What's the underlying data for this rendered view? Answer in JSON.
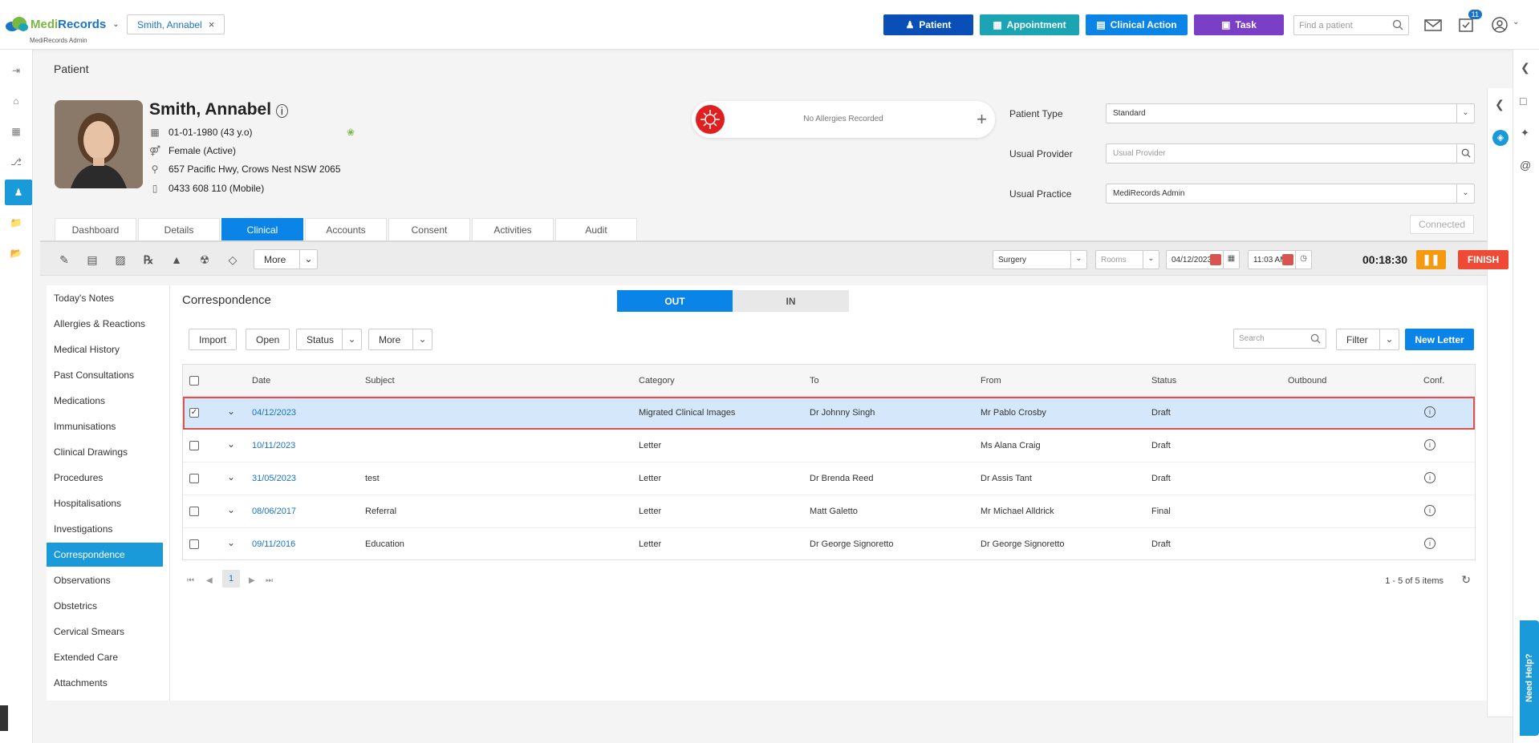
{
  "app": {
    "brand_medi": "Medi",
    "brand_records": "Records",
    "brand_sub": "MediRecords Admin"
  },
  "topbar": {
    "patient_chip": "Smith, Annabel",
    "buttons": [
      {
        "label": "Patient",
        "color": "#0a4fb8"
      },
      {
        "label": "Appointment",
        "color": "#1aa4b4"
      },
      {
        "label": "Clinical Action",
        "color": "#0a84e6"
      },
      {
        "label": "Task",
        "color": "#7a3fc6"
      }
    ],
    "find_placeholder": "Find a patient",
    "task_badge": "11"
  },
  "page": {
    "title": "Patient"
  },
  "patient": {
    "name": "Smith, Annabel",
    "dob": "01-01-1980 (43 y.o)",
    "gender": "Female (Active)",
    "address": "657 Pacific Hwy, Crows Nest NSW 2065",
    "phone": "0433 608 110 (Mobile)"
  },
  "allergies": {
    "text": "No Allergies Recorded"
  },
  "fields": {
    "patient_type_label": "Patient Type",
    "patient_type_value": "Standard",
    "usual_provider_label": "Usual Provider",
    "usual_provider_placeholder": "Usual Provider",
    "usual_practice_label": "Usual Practice",
    "usual_practice_value": "MediRecords Admin",
    "connected": "Connected"
  },
  "tabs": [
    {
      "label": "Dashboard"
    },
    {
      "label": "Details"
    },
    {
      "label": "Clinical"
    },
    {
      "label": "Accounts"
    },
    {
      "label": "Consent"
    },
    {
      "label": "Activities"
    },
    {
      "label": "Audit"
    }
  ],
  "toolbar": {
    "more": "More",
    "surgery": "Surgery",
    "rooms": "Rooms",
    "date": "04/12/2023",
    "time": "11:03 AM",
    "timer": "00:18:30",
    "finish": "FINISH"
  },
  "clinical_menu": [
    "Today's Notes",
    "Allergies & Reactions",
    "Medical History",
    "Past Consultations",
    "Medications",
    "Immunisations",
    "Clinical Drawings",
    "Procedures",
    "Hospitalisations",
    "Investigations",
    "Correspondence",
    "Observations",
    "Obstetrics",
    "Cervical Smears",
    "Extended Care",
    "Attachments"
  ],
  "correspondence": {
    "title": "Correspondence",
    "out_label": "OUT",
    "in_label": "IN",
    "import": "Import",
    "open": "Open",
    "status": "Status",
    "more": "More",
    "search_placeholder": "Search",
    "filter": "Filter",
    "new_letter": "New Letter",
    "columns": [
      "Date",
      "Subject",
      "Category",
      "To",
      "From",
      "Status",
      "Outbound",
      "Conf."
    ],
    "rows": [
      {
        "date": "04/12/2023",
        "subject": "",
        "category": "Migrated Clinical Images",
        "to": "Dr Johnny Singh",
        "from": "Mr Pablo Crosby",
        "status": "Draft"
      },
      {
        "date": "10/11/2023",
        "subject": "",
        "category": "Letter",
        "to": "",
        "from": "Ms Alana Craig",
        "status": "Draft"
      },
      {
        "date": "31/05/2023",
        "subject": "test",
        "category": "Letter",
        "to": "Dr Brenda Reed",
        "from": "Dr Assis Tant",
        "status": "Draft"
      },
      {
        "date": "08/06/2017",
        "subject": "Referral",
        "category": "Letter",
        "to": "Matt Galetto",
        "from": "Mr Michael Alldrick",
        "status": "Final"
      },
      {
        "date": "09/11/2016",
        "subject": "Education",
        "category": "Letter",
        "to": "Dr George Signoretto",
        "from": "Dr George Signoretto",
        "status": "Draft"
      }
    ],
    "page": "1",
    "count": "1 - 5 of 5 items"
  },
  "help": {
    "label": "Need Help?"
  }
}
